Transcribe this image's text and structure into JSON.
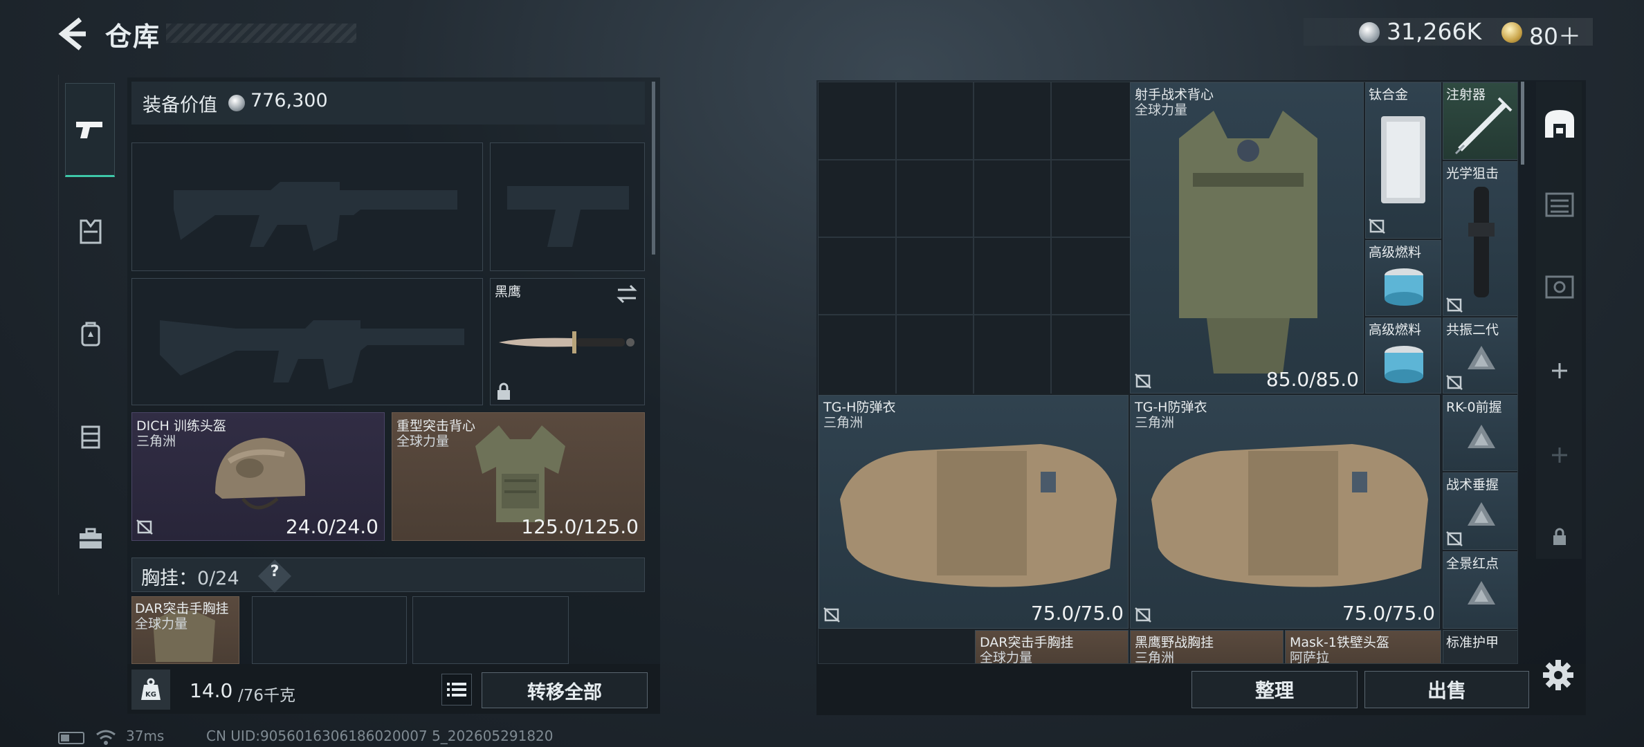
{
  "header": {
    "title": "仓库",
    "money": "31,266K",
    "gold": "80＋"
  },
  "left_tabs": [
    {
      "name": "weapon"
    },
    {
      "name": "armor"
    },
    {
      "name": "backpack"
    },
    {
      "name": "chest-rig"
    },
    {
      "name": "toolbox"
    }
  ],
  "equipment": {
    "value_label": "装备价值",
    "value": "776,300",
    "knife": {
      "name": "黑鹰"
    },
    "helmet": {
      "name": "DICH 训练头盔",
      "region": "三角洲",
      "durability": "24.0/24.0"
    },
    "vest": {
      "name": "重型突击背心",
      "region": "全球力量",
      "durability": "125.0/125.0"
    },
    "rig_label": "胸挂：",
    "rig_count": "0/24",
    "rig_help": "?",
    "rig_item": {
      "name": "DAR突击手胸挂",
      "region": "全球力量"
    }
  },
  "footer_left": {
    "weight_cur": "14.0",
    "weight_max": "/76千克",
    "transfer_all": "转移全部"
  },
  "stash_items": {
    "sniper_vest": {
      "name": "射手战术背心",
      "region": "全球力量",
      "durability": "85.0/85.0"
    },
    "titanium": {
      "name": "钛合金"
    },
    "syringe": {
      "name": "注射器"
    },
    "optical_scope": {
      "name": "光学狙击"
    },
    "fuel1": {
      "name": "高级燃料"
    },
    "fuel2": {
      "name": "高级燃料"
    },
    "resonance": {
      "name": "共振二代"
    },
    "tgh1": {
      "name": "TG-H防弹衣",
      "region": "三角洲",
      "durability": "75.0/75.0"
    },
    "tgh2": {
      "name": "TG-H防弹衣",
      "region": "三角洲",
      "durability": "75.0/75.0"
    },
    "rk0": {
      "name": "RK-0前握"
    },
    "tac_grip": {
      "name": "战术垂握"
    },
    "red_dot": {
      "name": "全景红点"
    },
    "dar_rig": {
      "name": "DAR突击手胸挂",
      "region": "全球力量"
    },
    "blackhawk_rig": {
      "name": "黑鹰野战胸挂",
      "region": "三角洲"
    },
    "mask1": {
      "name": "Mask-1铁壁头盔",
      "region": "阿萨拉"
    },
    "std_plate": {
      "name": "标准护甲"
    }
  },
  "footer_right": {
    "sort": "整理",
    "sell": "出售"
  },
  "status_bar": {
    "ping": "37ms",
    "uid": "CN UID:9056016306186020007 5_202605291820"
  },
  "colors": {
    "accent": "#3ec7a8",
    "tile_blue": "#30424f",
    "tile_tan": "#5a4a3e"
  }
}
